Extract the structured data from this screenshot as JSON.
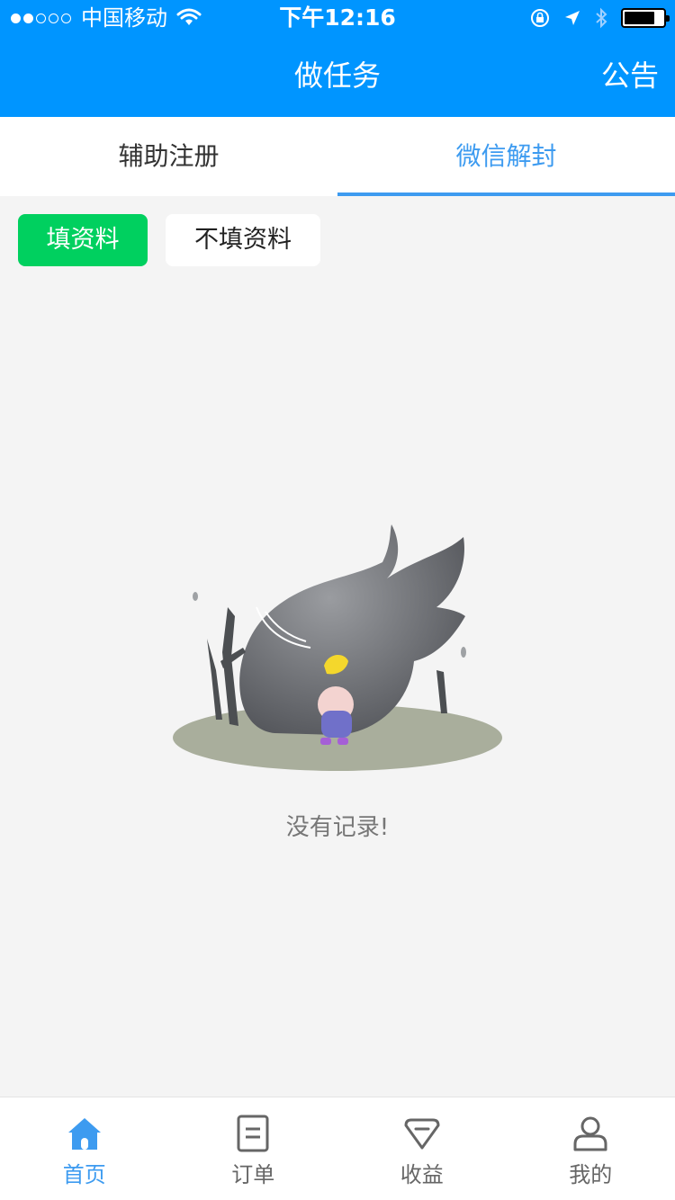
{
  "status_bar": {
    "carrier": "中国移动",
    "time": "下午12:16",
    "signal_bars_filled": 2,
    "signal_bars_total": 5
  },
  "nav": {
    "title": "做任务",
    "action": "公告"
  },
  "tabs": [
    {
      "label": "辅助注册",
      "active": false
    },
    {
      "label": "微信解封",
      "active": true
    }
  ],
  "filters": [
    {
      "label": "填资料",
      "active": true
    },
    {
      "label": "不填资料",
      "active": false
    }
  ],
  "empty_state": {
    "message": "没有记录!"
  },
  "bottom_nav": [
    {
      "label": "首页",
      "icon": "home-icon",
      "active": true
    },
    {
      "label": "订单",
      "icon": "order-icon",
      "active": false
    },
    {
      "label": "收益",
      "icon": "gem-icon",
      "active": false
    },
    {
      "label": "我的",
      "icon": "user-icon",
      "active": false
    }
  ],
  "colors": {
    "primary": "#0095ff",
    "tab_active": "#3d9bf0",
    "chip_active": "#00d05f",
    "background": "#f4f4f4"
  }
}
